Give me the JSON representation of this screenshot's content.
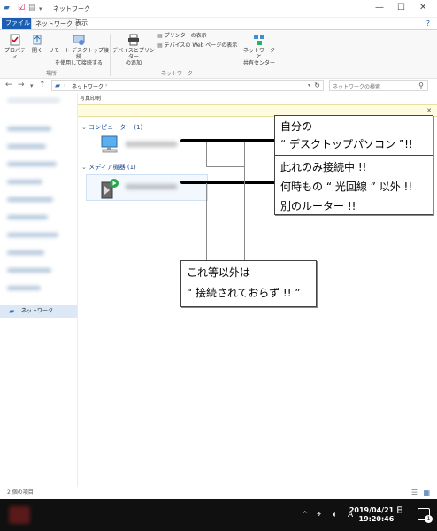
{
  "window": {
    "title": "ネットワーク",
    "controls": {
      "minimize": "—",
      "maximize": "☐",
      "close": "✕"
    }
  },
  "ribbon": {
    "tabs": [
      {
        "label": "ファイル"
      },
      {
        "label": "ネットワーク"
      },
      {
        "label": "表示"
      }
    ],
    "buttons": {
      "properties": "プロパティ",
      "open": "開く",
      "remote_desktop_line1": "リモート デスクトップ接続",
      "remote_desktop_line2": "を使用して接続する",
      "add_devices_line1": "デバイスとプリンター",
      "add_devices_line2": "の追加",
      "view_printers": "プリンターの表示",
      "view_device_web": "デバイスの Web ページの表示",
      "network_center_line1": "ネットワークと",
      "network_center_line2": "共有センター"
    },
    "groups": {
      "location": "場所",
      "network": "ネットワーク"
    }
  },
  "address": {
    "path": "ネットワーク",
    "search_placeholder": "ネットワークの検索"
  },
  "menustrip": {
    "label": "写真印刷"
  },
  "left_pane": {
    "network_item": "ネットワーク"
  },
  "content": {
    "section_computer": "コンピューター (1)",
    "section_media": "メディア機器 (1)"
  },
  "callouts": {
    "desktop": {
      "line1": "自分の",
      "line2": "“ デスクトップパソコン ”!!"
    },
    "router": {
      "line1": "此れのみ接続中 !!",
      "line2": "何時もの “ 光回線 ” 以外 !!",
      "line3": "別のルーター !!"
    },
    "not_connected": {
      "line1": "これ等以外は",
      "line2": "“ 接続されておらず !! ”"
    }
  },
  "status": {
    "item_count": "2 個の項目"
  },
  "taskbar": {
    "ime": "A",
    "date": "2019/04/21 日",
    "time": "19:20:46",
    "notification_count": "1"
  },
  "colors": {
    "file_tab": "#1a5fb4",
    "section_header": "#1f4e8c",
    "info_bar": "#fffbe0",
    "taskbar": "#101010",
    "nav_selected": "#dce8f5"
  }
}
